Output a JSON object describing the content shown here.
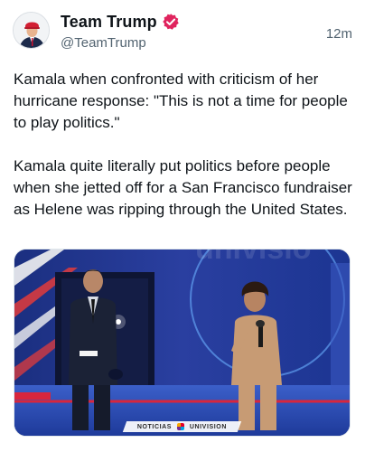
{
  "author": {
    "display_name": "Team Trump",
    "handle": "@TeamTrump",
    "verified": true,
    "verified_color": "#e0245e"
  },
  "timestamp": "12m",
  "tweet": {
    "paragraphs": [
      "Kamala when confronted with criticism of her hurricane response: \"This is not a time for people to play politics.\"",
      "Kamala quite literally put politics before people when she jetted off for a San Francisco fundraiser as Helene was ripping through the United States."
    ]
  },
  "media": {
    "lower_third_left": "NOTICIAS",
    "lower_third_right": "UNIVISION",
    "backdrop_text": "univisio"
  },
  "icons": {
    "verified": "verified-badge-icon",
    "avatar": "avatar-image"
  }
}
